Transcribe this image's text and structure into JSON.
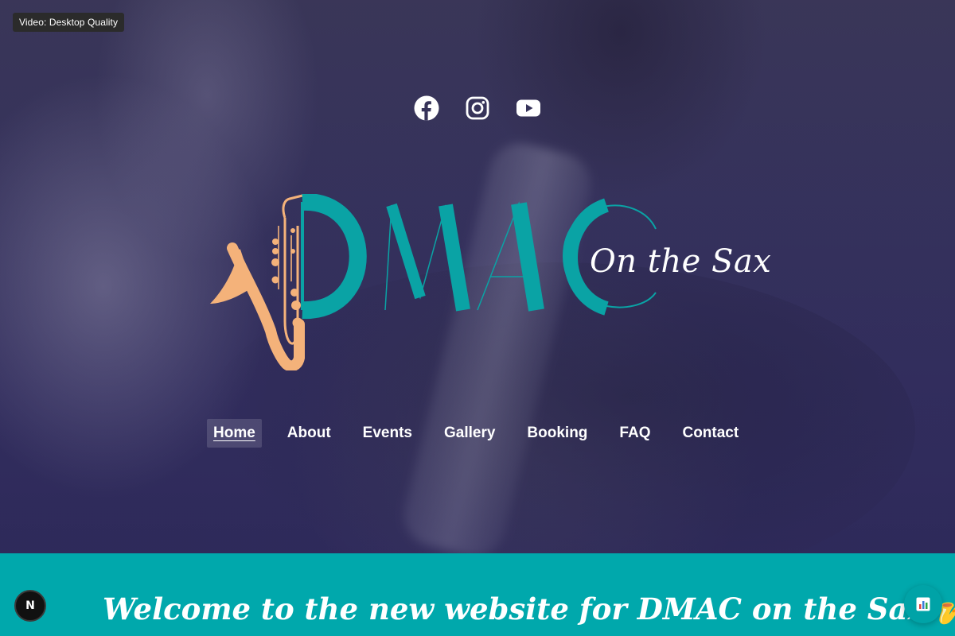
{
  "video_badge": {
    "label": "Video: Desktop Quality"
  },
  "social_links": [
    {
      "icon": "facebook-icon"
    },
    {
      "icon": "instagram-icon"
    },
    {
      "icon": "youtube-icon"
    }
  ],
  "logo": {
    "wordmark": "DMAC",
    "tagline": "On the Sax"
  },
  "nav": {
    "items": [
      {
        "label": "Home",
        "active": true
      },
      {
        "label": "About"
      },
      {
        "label": "Events"
      },
      {
        "label": "Gallery"
      },
      {
        "label": "Booking"
      },
      {
        "label": "FAQ"
      },
      {
        "label": "Contact"
      }
    ]
  },
  "welcome": {
    "heading": "Welcome to the new website for DMAC on the Sax 🎷"
  },
  "dev_badge": {
    "label": "N"
  },
  "colors": {
    "teal": "#00a8ac",
    "sax_orange": "#f4b27a",
    "hero_overlay": "#332f5c"
  }
}
